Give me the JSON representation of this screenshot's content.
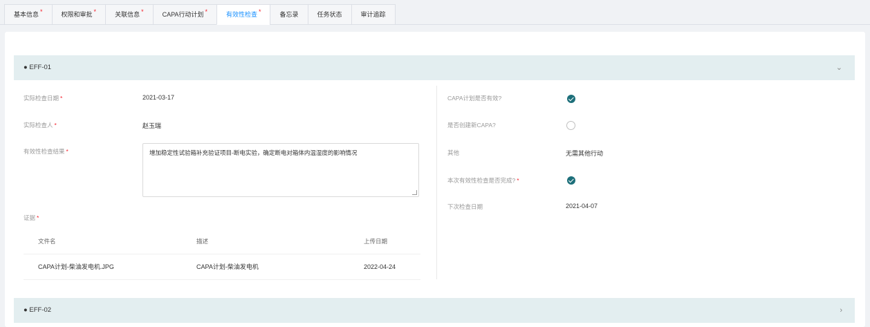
{
  "tabs": [
    {
      "label": "基本信息",
      "required": "*"
    },
    {
      "label": "权限和审批",
      "required": "*"
    },
    {
      "label": "关联信息",
      "required": "*"
    },
    {
      "label": "CAPA行动计划",
      "required": "*"
    },
    {
      "label": "有效性检查",
      "required": "*"
    },
    {
      "label": "备忘录",
      "required": ""
    },
    {
      "label": "任务状态",
      "required": ""
    },
    {
      "label": "审计追踪",
      "required": ""
    }
  ],
  "active_tab": "有效性检查",
  "panels": [
    {
      "title": "● EFF-01",
      "chevron": "⌄"
    },
    {
      "title": "● EFF-02",
      "chevron": "›"
    }
  ],
  "form": {
    "actual_date_label": "实际检查日期",
    "actual_date_value": "2021-03-17",
    "inspector_label": "实际检查人",
    "inspector_value": "赵玉瑞",
    "result_label": "有效性检查结果",
    "result_value": "增加稳定性试验箱补充验证项目-断电实验，确定断电对箱体内温湿度的影响情况",
    "evidence_label": "证据",
    "required_mark": "*",
    "capa_effective_label": "CAPA计划是否有效?",
    "create_new_capa_label": "是否创建新CAPA?",
    "other_label": "其他",
    "other_value": "无需其他行动",
    "completed_label": "本次有效性检查是否完成?",
    "next_date_label": "下次检查日期",
    "next_date_value": "2021-04-07"
  },
  "evidence_table": {
    "headers": [
      "文件名",
      "描述",
      "上传日期"
    ],
    "rows": [
      [
        "CAPA计划-柴油发电机.JPG",
        "CAPA计划-柴油发电机",
        "2022-04-24"
      ]
    ]
  },
  "colors": {
    "accent": "#1890ff",
    "check": "#1d6f7a",
    "panel": "#e3eef0",
    "required": "#f5222d"
  }
}
